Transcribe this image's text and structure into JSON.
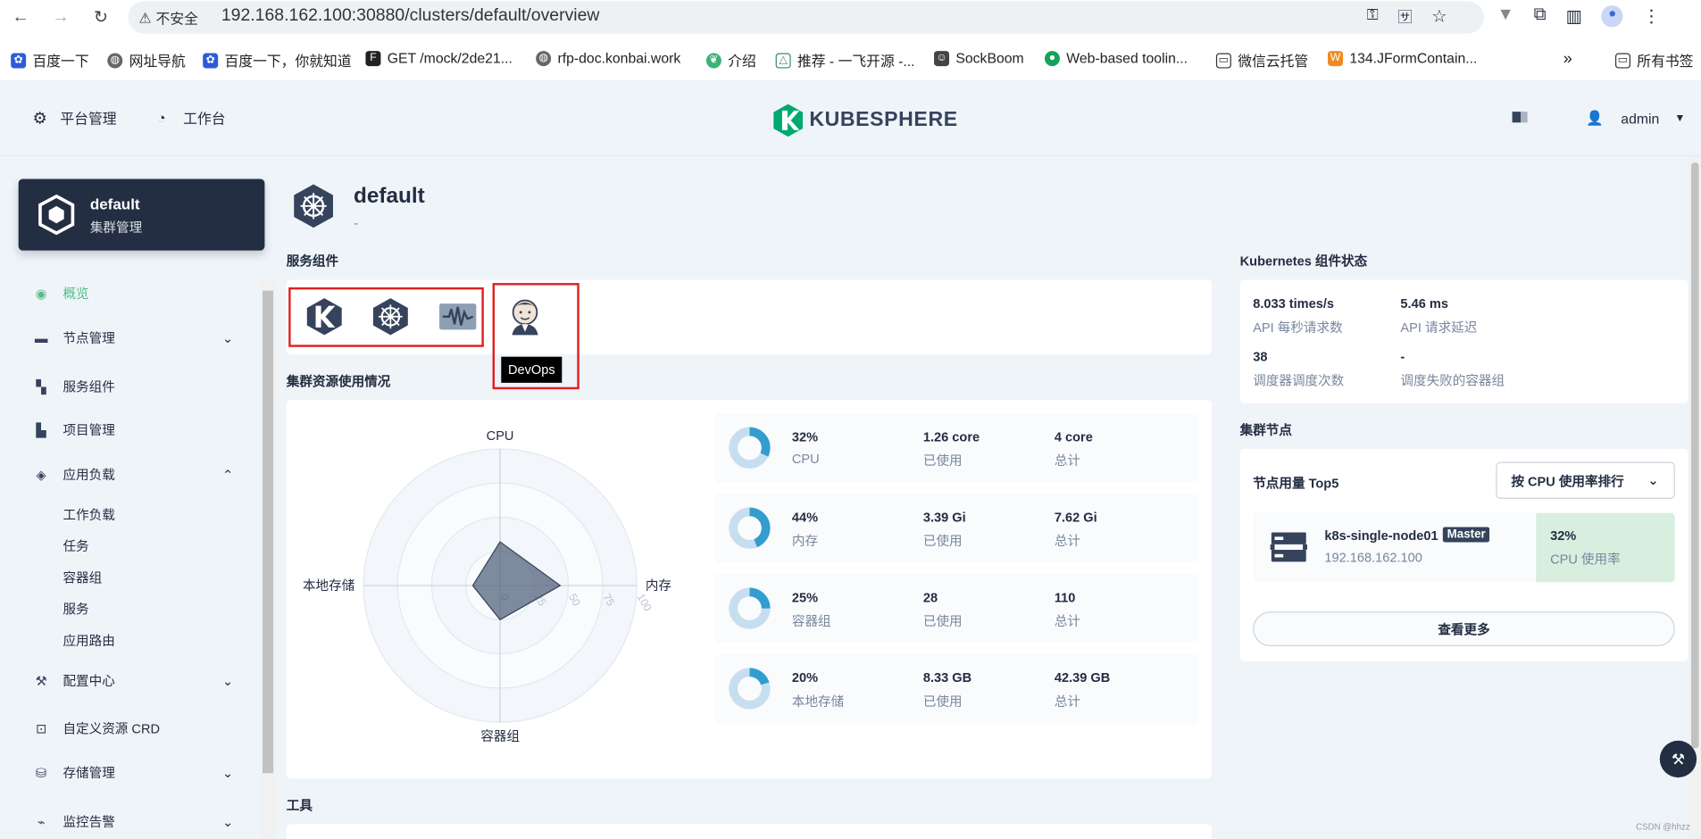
{
  "browser": {
    "insecure_label": "不安全",
    "url": "192.168.162.100:30880/clusters/default/overview",
    "bookmarks": [
      {
        "label": "百度一下",
        "icon": "baidu-icon"
      },
      {
        "label": "网址导航",
        "icon": "globe-icon"
      },
      {
        "label": "百度一下，你就知道",
        "icon": "baidu-icon"
      },
      {
        "label": "GET /mock/2de21...",
        "icon": "terminal-icon"
      },
      {
        "label": "rfp-doc.konbai.work",
        "icon": "globe-icon"
      },
      {
        "label": "介绍",
        "icon": "leaf-icon"
      },
      {
        "label": "推荐 - 一飞开源 -...",
        "icon": "triangle-icon"
      },
      {
        "label": "SockBoom",
        "icon": "robot-icon"
      },
      {
        "label": "Web-based toolin...",
        "icon": "green-circle-icon"
      },
      {
        "label": "微信云托管",
        "icon": "folder-icon"
      },
      {
        "label": "134.JFormContain...",
        "icon": "w-icon"
      }
    ],
    "overflow": "»",
    "all_bookmarks": "所有书签"
  },
  "header": {
    "platform": "平台管理",
    "workbench": "工作台",
    "logo": "KUBESPHERE",
    "user": "admin"
  },
  "sidebar": {
    "cluster_name": "default",
    "cluster_sub": "集群管理",
    "items": [
      {
        "label": "概览"
      },
      {
        "label": "节点管理"
      },
      {
        "label": "服务组件"
      },
      {
        "label": "项目管理"
      },
      {
        "label": "应用负载"
      },
      {
        "label": "配置中心"
      },
      {
        "label": "自定义资源 CRD"
      },
      {
        "label": "存储管理"
      },
      {
        "label": "监控告警"
      }
    ],
    "workload_sub": [
      "工作负载",
      "任务",
      "容器组",
      "服务",
      "应用路由"
    ]
  },
  "main": {
    "title": "default",
    "desc": "-",
    "services_title": "服务组件",
    "tooltip": "DevOps",
    "usage_title": "集群资源使用情况",
    "tools_title": "工具",
    "resources": [
      {
        "pct": "32%",
        "name": "CPU",
        "used": "1.26 core",
        "used_label": "已使用",
        "total": "4 core",
        "total_label": "总计",
        "fraction": 0.32
      },
      {
        "pct": "44%",
        "name": "内存",
        "used": "3.39 Gi",
        "used_label": "已使用",
        "total": "7.62 Gi",
        "total_label": "总计",
        "fraction": 0.44
      },
      {
        "pct": "25%",
        "name": "容器组",
        "used": "28",
        "used_label": "已使用",
        "total": "110",
        "total_label": "总计",
        "fraction": 0.25
      },
      {
        "pct": "20%",
        "name": "本地存储",
        "used": "8.33 GB",
        "used_label": "已使用",
        "total": "42.39 GB",
        "total_label": "总计",
        "fraction": 0.2
      }
    ]
  },
  "chart_data": {
    "type": "radar",
    "axes": [
      "CPU",
      "内存",
      "容器组",
      "本地存储"
    ],
    "values": [
      32,
      44,
      25,
      20
    ],
    "rlim": [
      0,
      100
    ],
    "ticks": [
      "0",
      "25",
      "50",
      "75",
      "100"
    ]
  },
  "k8s": {
    "title": "Kubernetes 组件状态",
    "stats": [
      {
        "value": "8.033 times/s",
        "label": "API 每秒请求数"
      },
      {
        "value": "5.46 ms",
        "label": "API 请求延迟"
      },
      {
        "value": "38",
        "label": "调度器调度次数"
      },
      {
        "value": "-",
        "label": "调度失败的容器组"
      }
    ]
  },
  "nodes": {
    "title": "集群节点",
    "top_label": "节点用量 Top5",
    "sort_label": "按 CPU 使用率排行",
    "node": {
      "name": "k8s-single-node01",
      "badge": "Master",
      "ip": "192.168.162.100",
      "usage": "32%",
      "usage_label": "CPU 使用率"
    },
    "more": "查看更多"
  },
  "watermark": "CSDN @hhzz",
  "colors": {
    "accent": "#55bc8a",
    "ring": "#329dce",
    "ring_bg": "#c7deef",
    "highlight": "#e02020"
  }
}
